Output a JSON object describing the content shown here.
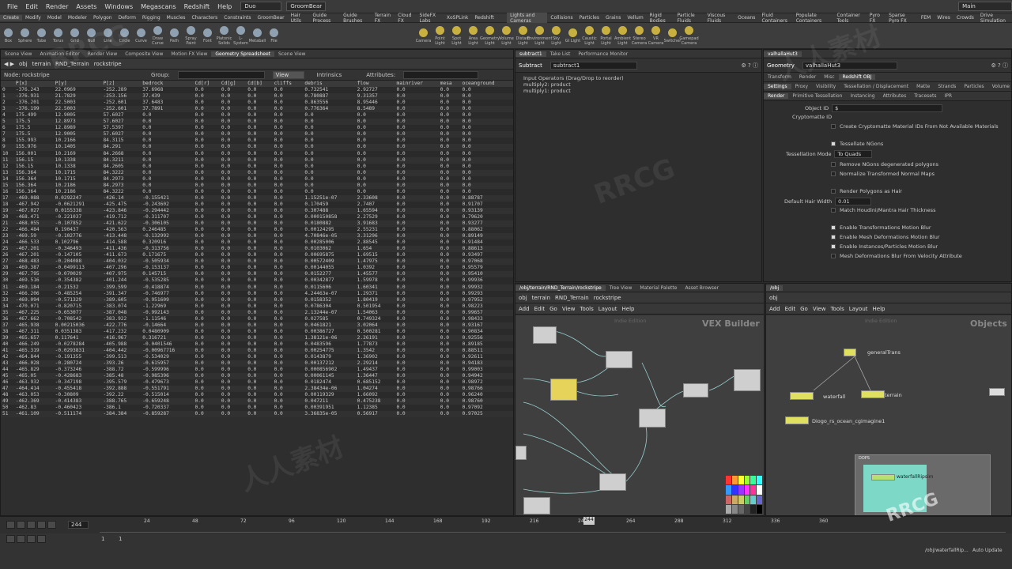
{
  "menu": [
    "File",
    "Edit",
    "Render",
    "Assets",
    "Windows",
    "Megascans",
    "Redshift",
    "Help"
  ],
  "desktop": "Duo",
  "groom_label": "GroomBear",
  "main_label": "Main",
  "shelf_tabs_left": [
    "Create",
    "Modify",
    "Model",
    "Modeler",
    "Polygon",
    "Deform",
    "Rigging",
    "Muscles",
    "Characters",
    "Constraints",
    "GroomBear",
    "Hair Utils",
    "Guide Process",
    "Guide Brushes",
    "Terrain FX",
    "Cloud FX",
    "SideFX Labs",
    "XoSPLink",
    "Redshift"
  ],
  "shelf_tabs_right": [
    "Lights and Cameras",
    "Collisions",
    "Particles",
    "Grains",
    "Vellum",
    "Rigid Bodies",
    "Particle Fluids",
    "Viscous Fluids",
    "Oceans",
    "Fluid Containers",
    "Populate Containers",
    "Container Tools",
    "Pyro FX",
    "Sparse Pyro FX",
    "FEM",
    "Wires",
    "Crowds",
    "Drive Simulation"
  ],
  "tools_left": [
    "Box",
    "Sphere",
    "Tube",
    "Torus",
    "Grid",
    "Null",
    "Line",
    "Circle",
    "Curve",
    "Draw Curve",
    "Path",
    "Spray Paint",
    "Font",
    "Platonic Solids",
    "L-System",
    "Metaball",
    "File"
  ],
  "tools_right": [
    "Camera",
    "Point Light",
    "Spot Light",
    "Area Light",
    "Geometry Light",
    "Volume Light",
    "Distant Light",
    "Environment Light",
    "Sky Light",
    "GI Light",
    "Caustic Light",
    "Portal Light",
    "Ambient Light",
    "Stereo Camera",
    "VR Camera",
    "Switcher",
    "Gamepad Camera"
  ],
  "left_tabs": [
    "Scene View",
    "Animation Editor",
    "Render View",
    "Composite View",
    "Motion FX View",
    "Geometry Spreadsheet",
    "Scene View"
  ],
  "path": {
    "obj": "obj",
    "terrain": "terrain",
    "rnd": "RND_Terrain",
    "rock": "rockstripe"
  },
  "ss": {
    "node_label": "Node: rockstripe",
    "group": "Group:",
    "view": "View",
    "intrinsics": "Intrinsics",
    "attributes": "Attributes:",
    "cols": [
      "",
      "P[x]",
      "P[y]",
      "P[z]",
      "bedrock",
      "Cd[r]",
      "Cd[g]",
      "Cd[b]",
      "cliffs",
      "debris",
      "flow",
      "mainriver",
      "mesa",
      "oceanground"
    ],
    "rows": [
      [
        "0",
        "-376.243",
        "22.0969",
        "-252.289",
        "37.6968",
        "0.0",
        "0.0",
        "0.0",
        "0.0",
        "0.732541",
        "2.92727",
        "0.0",
        "0.0",
        "0.0"
      ],
      [
        "1",
        "-376.931",
        "21.7829",
        "-253.156",
        "37.439",
        "0.0",
        "0.0",
        "0.0",
        "0.0",
        "0.780887",
        "9.31357",
        "0.0",
        "0.0",
        "0.0"
      ],
      [
        "2",
        "-376.201",
        "22.5003",
        "-252.601",
        "37.6483",
        "0.0",
        "0.0",
        "0.0",
        "0.0",
        "0.863556",
        "8.95446",
        "0.0",
        "0.0",
        "0.0"
      ],
      [
        "3",
        "-376.199",
        "22.5003",
        "-252.601",
        "37.7891",
        "0.0",
        "0.0",
        "0.0",
        "0.0",
        "0.776364",
        "8.5489",
        "0.0",
        "0.0",
        "0.0"
      ],
      [
        "4",
        "175.499",
        "12.9005",
        "57.6027",
        "0.0",
        "0.0",
        "0.0",
        "0.0",
        "0.0",
        "0.0",
        "0.0",
        "0.0",
        "0.0",
        "0.0"
      ],
      [
        "5",
        "175.5",
        "12.8973",
        "57.6027",
        "0.0",
        "0.0",
        "0.0",
        "0.0",
        "0.0",
        "0.0",
        "0.0",
        "0.0",
        "0.0",
        "0.0"
      ],
      [
        "6",
        "175.5",
        "12.8989",
        "57.5397",
        "0.0",
        "0.0",
        "0.0",
        "0.0",
        "0.0",
        "0.0",
        "0.0",
        "0.0",
        "0.0",
        "0.0"
      ],
      [
        "7",
        "175.5",
        "12.9005",
        "57.6027",
        "0.0",
        "0.0",
        "0.0",
        "0.0",
        "0.0",
        "0.0",
        "0.0",
        "0.0",
        "0.0",
        "0.0"
      ],
      [
        "8",
        "155.993",
        "10.2166",
        "84.3115",
        "0.0",
        "0.0",
        "0.0",
        "0.0",
        "0.0",
        "0.0",
        "0.0",
        "0.0",
        "0.0",
        "0.0"
      ],
      [
        "9",
        "155.976",
        "10.1405",
        "84.291",
        "0.0",
        "0.0",
        "0.0",
        "0.0",
        "0.0",
        "0.0",
        "0.0",
        "0.0",
        "0.0",
        "0.0"
      ],
      [
        "10",
        "156.001",
        "10.2169",
        "84.2668",
        "0.0",
        "0.0",
        "0.0",
        "0.0",
        "0.0",
        "0.0",
        "0.0",
        "0.0",
        "0.0",
        "0.0"
      ],
      [
        "11",
        "156.15",
        "10.1338",
        "84.3211",
        "0.0",
        "0.0",
        "0.0",
        "0.0",
        "0.0",
        "0.0",
        "0.0",
        "0.0",
        "0.0",
        "0.0"
      ],
      [
        "12",
        "156.15",
        "10.1338",
        "84.2605",
        "0.0",
        "0.0",
        "0.0",
        "0.0",
        "0.0",
        "0.0",
        "0.0",
        "0.0",
        "0.0",
        "0.0"
      ],
      [
        "13",
        "156.364",
        "10.1715",
        "84.3222",
        "0.0",
        "0.0",
        "0.0",
        "0.0",
        "0.0",
        "0.0",
        "0.0",
        "0.0",
        "0.0",
        "0.0"
      ],
      [
        "14",
        "156.364",
        "10.1715",
        "84.2973",
        "0.0",
        "0.0",
        "0.0",
        "0.0",
        "0.0",
        "0.0",
        "0.0",
        "0.0",
        "0.0",
        "0.0"
      ],
      [
        "15",
        "156.364",
        "10.2186",
        "84.2973",
        "0.0",
        "0.0",
        "0.0",
        "0.0",
        "0.0",
        "0.0",
        "0.0",
        "0.0",
        "0.0",
        "0.0"
      ],
      [
        "16",
        "156.364",
        "10.2186",
        "84.3222",
        "0.0",
        "0.0",
        "0.0",
        "0.0",
        "0.0",
        "0.0",
        "0.0",
        "0.0",
        "0.0",
        "0.0"
      ],
      [
        "17",
        "-469.088",
        "0.0292247",
        "-426.14",
        "-0.155421",
        "0.0",
        "0.0",
        "0.0",
        "0.0",
        "1.15251e-07",
        "2.33608",
        "0.0",
        "0.0",
        "0.88787"
      ],
      [
        "18",
        "-467.942",
        "-0.0621291",
        "-425.475",
        "-0.243602",
        "0.0",
        "0.0",
        "0.0",
        "0.0",
        "0.170459",
        "2.7407",
        "0.0",
        "0.0",
        "0.91707"
      ],
      [
        "19",
        "-467.027",
        "0.0155338",
        "-423.846",
        "-0.294442",
        "0.0",
        "0.0",
        "0.0",
        "0.0",
        "0.307488",
        "1.65594",
        "0.0",
        "0.0",
        "0.93139"
      ],
      [
        "20",
        "-468.471",
        "-0.221037",
        "-419.712",
        "-0.311707",
        "0.0",
        "0.0",
        "0.0",
        "0.0",
        "0.000150858",
        "2.27529",
        "0.0",
        "0.0",
        "0.79620"
      ],
      [
        "21",
        "-468.055",
        "-0.107852",
        "-421.622",
        "-0.306105",
        "0.0",
        "0.0",
        "0.0",
        "0.0",
        "0.0180882",
        "3.91683",
        "0.0",
        "0.0",
        "0.93277"
      ],
      [
        "22",
        "-466.484",
        "0.190437",
        "-420.563",
        "0.246485",
        "0.0",
        "0.0",
        "0.0",
        "0.0",
        "0.00124295",
        "2.55231",
        "0.0",
        "0.0",
        "0.88062"
      ],
      [
        "23",
        "-469.59",
        "-0.102776",
        "-413.448",
        "-0.132992",
        "0.0",
        "0.0",
        "0.0",
        "0.0",
        "4.70846e-05",
        "3.31296",
        "0.0",
        "0.0",
        "0.89149"
      ],
      [
        "24",
        "-466.533",
        "0.102796",
        "-414.588",
        "0.320916",
        "0.0",
        "0.0",
        "0.0",
        "0.0",
        "0.00285006",
        "2.88545",
        "0.0",
        "0.0",
        "0.91484"
      ],
      [
        "25",
        "-467.201",
        "-0.346493",
        "-411.436",
        "-0.313756",
        "0.0",
        "0.0",
        "0.0",
        "0.0",
        "0.0103062",
        "1.654",
        "0.0",
        "0.0",
        "0.88613"
      ],
      [
        "26",
        "-467.201",
        "-0.147105",
        "-411.673",
        "0.171675",
        "0.0",
        "0.0",
        "0.0",
        "0.0",
        "0.00695875",
        "1.69515",
        "0.0",
        "0.0",
        "0.93497"
      ],
      [
        "27",
        "-468.483",
        "-0.204088",
        "-404.032",
        "-0.505934",
        "0.0",
        "0.0",
        "0.0",
        "0.0",
        "0.00572409",
        "1.47975",
        "0.0",
        "0.0",
        "0.97068"
      ],
      [
        "28",
        "-469.387",
        "-0.0499113",
        "-407.296",
        "-0.153137",
        "0.0",
        "0.0",
        "0.0",
        "0.0",
        "0.00144055",
        "1.0392",
        "0.0",
        "0.0",
        "0.95579"
      ],
      [
        "29",
        "-467.795",
        "-0.070029",
        "-407.975",
        "0.145715",
        "0.0",
        "0.0",
        "0.0",
        "0.0",
        "0.0152277",
        "1.45577",
        "0.0",
        "0.0",
        "0.95410"
      ],
      [
        "30",
        "-469.516",
        "-0.354382",
        "-401.244",
        "-0.535285",
        "0.0",
        "0.0",
        "0.0",
        "0.0",
        "0.00342877",
        "1.59978",
        "0.0",
        "0.0",
        "0.99936"
      ],
      [
        "31",
        "-469.184",
        "-0.21532",
        "-399.599",
        "-0.418874",
        "0.0",
        "0.0",
        "0.0",
        "0.0",
        "0.0115606",
        "1.60341",
        "0.0",
        "0.0",
        "0.99932"
      ],
      [
        "32",
        "-466.206",
        "-0.485254",
        "-391.347",
        "-0.746977",
        "0.0",
        "0.0",
        "0.0",
        "0.0",
        "4.24463e-07",
        "1.29371",
        "0.0",
        "0.0",
        "0.99293"
      ],
      [
        "33",
        "-469.094",
        "-0.571329",
        "-389.605",
        "-0.951609",
        "0.0",
        "0.0",
        "0.0",
        "0.0",
        "0.0158352",
        "1.80419",
        "0.0",
        "0.0",
        "0.97952"
      ],
      [
        "34",
        "-470.071",
        "-0.820715",
        "-383.074",
        "-1.22969",
        "0.0",
        "0.0",
        "0.0",
        "0.0",
        "0.0786304",
        "0.501954",
        "0.0",
        "0.0",
        "0.98223"
      ],
      [
        "35",
        "-467.225",
        "-0.653077",
        "-387.048",
        "-0.992143",
        "0.0",
        "0.0",
        "0.0",
        "0.0",
        "2.13244e-07",
        "1.54063",
        "0.0",
        "0.0",
        "0.99657"
      ],
      [
        "36",
        "-467.662",
        "-0.708542",
        "-383.922",
        "-1.11546",
        "0.0",
        "0.0",
        "0.0",
        "0.0",
        "0.027585",
        "0.749324",
        "0.0",
        "0.0",
        "0.98433"
      ],
      [
        "37",
        "-465.938",
        "0.00215036",
        "-422.776",
        "-0.14664",
        "0.0",
        "0.0",
        "0.0",
        "0.0",
        "0.0461821",
        "3.02064",
        "0.0",
        "0.0",
        "0.93167"
      ],
      [
        "38",
        "-467.311",
        "0.0351383",
        "-417.232",
        "0.0480909",
        "0.0",
        "0.0",
        "0.0",
        "0.0",
        "0.00386727",
        "0.500281",
        "0.0",
        "0.0",
        "0.90834"
      ],
      [
        "39",
        "-465.657",
        "0.117641",
        "-416.967",
        "0.316721",
        "0.0",
        "0.0",
        "0.0",
        "0.0",
        "1.38121e-06",
        "2.26191",
        "0.0",
        "0.0",
        "0.92556"
      ],
      [
        "40",
        "-466.249",
        "-0.0278284",
        "-405.988",
        "-0.0401546",
        "0.0",
        "0.0",
        "0.0",
        "0.0",
        "0.0483596",
        "1.77873",
        "0.0",
        "0.0",
        "0.89185"
      ],
      [
        "41",
        "-465.319",
        "-0.0293831",
        "-404.442",
        "-0.00967716",
        "0.0",
        "0.0",
        "0.0",
        "0.0",
        "0.00254775",
        "1.3542",
        "0.0",
        "0.0",
        "0.88511"
      ],
      [
        "42",
        "-464.844",
        "-0.191355",
        "-399.513",
        "-0.534029",
        "0.0",
        "0.0",
        "0.0",
        "0.0",
        "0.0143879",
        "1.36902",
        "0.0",
        "0.0",
        "0.92611"
      ],
      [
        "43",
        "-466.028",
        "-0.280724",
        "-393.26",
        "-0.615957",
        "0.0",
        "0.0",
        "0.0",
        "0.0",
        "0.00137212",
        "2.29214",
        "0.0",
        "0.0",
        "0.94183"
      ],
      [
        "44",
        "-465.829",
        "-0.373246",
        "-388.72",
        "-0.599996",
        "0.0",
        "0.0",
        "0.0",
        "0.0",
        "0.000856902",
        "1.49437",
        "0.0",
        "0.0",
        "0.99003"
      ],
      [
        "45",
        "-465.05",
        "-0.428683",
        "-385.48",
        "-0.985396",
        "0.0",
        "0.0",
        "0.0",
        "0.0",
        "0.00061145",
        "1.36447",
        "0.0",
        "0.0",
        "0.94942"
      ],
      [
        "46",
        "-463.932",
        "-0.347198",
        "-395.579",
        "-0.479673",
        "0.0",
        "0.0",
        "0.0",
        "0.0",
        "0.0182474",
        "0.685152",
        "0.0",
        "0.0",
        "0.98972"
      ],
      [
        "47",
        "-464.414",
        "-0.455418",
        "-392.888",
        "-0.551791",
        "0.0",
        "0.0",
        "0.0",
        "0.0",
        "2.38434e-06",
        "1.04274",
        "0.0",
        "0.0",
        "0.98766"
      ],
      [
        "48",
        "-463.053",
        "-0.30809",
        "-392.22",
        "-0.515014",
        "0.0",
        "0.0",
        "0.0",
        "0.0",
        "0.00119329",
        "1.66092",
        "0.0",
        "0.0",
        "0.96240"
      ],
      [
        "49",
        "-462.369",
        "-0.414383",
        "-388.765",
        "-0.659248",
        "0.0",
        "0.0",
        "0.0",
        "0.0",
        "0.047211",
        "0.475238",
        "0.0",
        "0.0",
        "0.98760"
      ],
      [
        "50",
        "-462.83",
        "-0.460423",
        "-386.1",
        "-0.720337",
        "0.0",
        "0.0",
        "0.0",
        "0.0",
        "0.00391951",
        "1.12385",
        "0.0",
        "0.0",
        "0.97092"
      ],
      [
        "51",
        "-461.109",
        "-0.511174",
        "-384.384",
        "-0.859287",
        "0.0",
        "0.0",
        "0.0",
        "0.0",
        "3.36835e-05",
        "0.56917",
        "0.0",
        "0.0",
        "0.97025"
      ]
    ]
  },
  "sub": {
    "tabs": [
      "subtract1",
      "Take List",
      "Performance Monitor"
    ],
    "kind": "Subtract",
    "name": "subtract1",
    "input_label": "Input Operators (Drag/Drop to reorder)",
    "inputs": [
      "multiply2: product",
      "multiply1: product"
    ]
  },
  "geo": {
    "tabs": [
      "valhallaHut3"
    ],
    "kind": "Geometry",
    "name": "valhallaHut3",
    "tabs2": [
      "Transform",
      "Render",
      "Misc",
      "Redshift OBJ"
    ],
    "tabs3": [
      "Settings",
      "Proxy",
      "Visibility",
      "Tessellation / Displacement",
      "Matte",
      "Strands",
      "Particles",
      "Volume"
    ],
    "tabs4": [
      "Render",
      "Primitive Tessellation",
      "Instancing",
      "Attributes",
      "Tracesets",
      "IPR"
    ],
    "object_id_label": "Object ID",
    "object_id": "$",
    "crypto_label": "Cryptomatte ID",
    "crypto_chk": "Create Cryptomatte Material IDs From Not Available Materials",
    "tess_ngons": "Tessellate NGons",
    "tess_mode_label": "Tessellation Mode",
    "tess_mode": "To Quads",
    "remove_ngons": "Remove NGons degenerated polygons",
    "normalize": "Normalize Transformed Normal Maps",
    "render_hair": "Render Polygons as Hair",
    "hair_width_label": "Default Hair Width",
    "hair_width": "0.01",
    "match_hair": "Match Houdini/Mantra Hair Thickness",
    "mb1": "Enable Transformations Motion Blur",
    "mb2": "Enable Mesh Deformations Motion Blur",
    "mb3": "Enable Instances/Particles Motion Blur",
    "mb4": "Mesh Deformations Blur From Velocity Attribute"
  },
  "vex": {
    "tabs": [
      "/obj/terrain/RND_Terrain/rockstripe",
      "Tree View",
      "Material Palette",
      "Asset Browser"
    ],
    "menu": [
      "Add",
      "Edit",
      "Go",
      "View",
      "Tools",
      "Layout",
      "Help"
    ],
    "edition": "Indie Edition",
    "title": "VEX Builder"
  },
  "objnet": {
    "tabs": [
      "/obj"
    ],
    "path": "obj",
    "menu": [
      "Add",
      "Edit",
      "Go",
      "View",
      "Tools",
      "Layout",
      "Help"
    ],
    "edition": "Indie Edition",
    "title": "Objects",
    "nodes": [
      "generalTrans",
      "waterfall",
      "terrain",
      "Diogo_rs_ocean_cgimagine1"
    ],
    "dops": "DOPS",
    "dop_node": "waterfallRipsim"
  },
  "timeline": {
    "frame": "244",
    "ticks": [
      "24",
      "48",
      "72",
      "96",
      "120",
      "144",
      "168",
      "192",
      "216",
      "240",
      "264",
      "288",
      "312",
      "336",
      "360"
    ],
    "start": "1",
    "end": "1"
  },
  "status": {
    "path": "/obj/waterfallRip...",
    "autoupdate": "Auto Update"
  },
  "watermarks": [
    "RRCG",
    "人人素材",
    "RRCG",
    "人人素材",
    "RRCG"
  ]
}
